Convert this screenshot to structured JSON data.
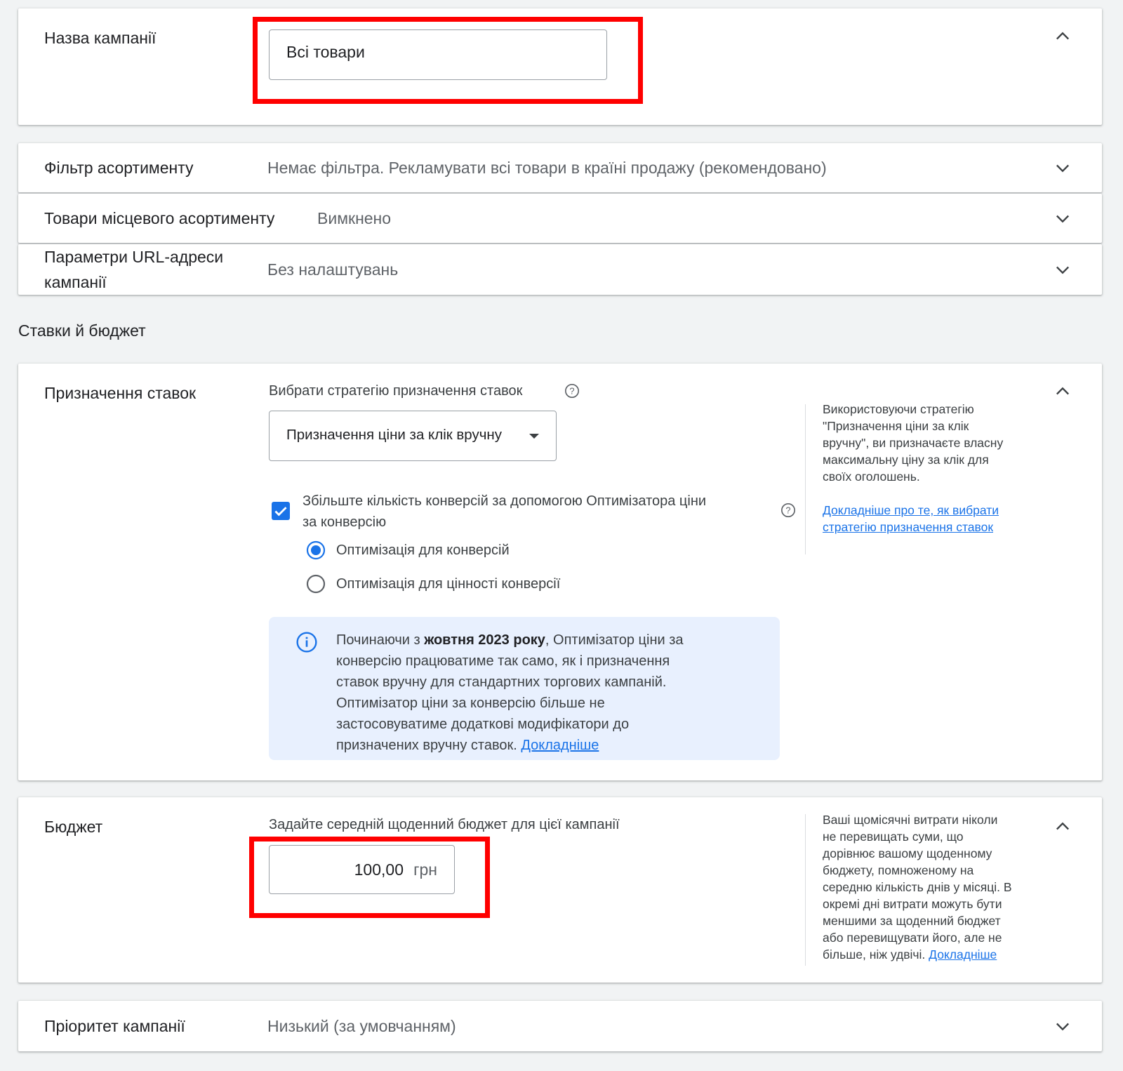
{
  "campaign_name": {
    "label": "Назва кампанії",
    "value": "Всі товари"
  },
  "inventory_filter": {
    "label": "Фільтр асортименту",
    "value": "Немає фільтра. Рекламувати всі товари в країні продажу (рекомендовано)"
  },
  "local_products": {
    "label": "Товари місцевого асортименту",
    "value": "Вимкнено"
  },
  "url_params": {
    "label_line1": "Параметри URL-адреси",
    "label_line2": "кампанії",
    "value": "Без налаштувань"
  },
  "section_title": "Ставки й бюджет",
  "bidding": {
    "label": "Призначення ставок",
    "strategy_prompt": "Вибрати стратегію призначення ставок",
    "strategy_selected": "Призначення ціни за клік вручну",
    "ecpc_label_line1": "Збільште кількість конверсій за допомогою Оптимізатора ціни",
    "ecpc_label_line2": "за конверсію",
    "ecpc_checked": true,
    "radio_conversions": "Оптимізація для конверсій",
    "radio_value": "Оптимізація для цінності конверсії",
    "radio_selected": "conversions",
    "notice_prefix": "Починаючи з ",
    "notice_bold": "жовтня 2023 року",
    "notice_line1_rest": ", Оптимізатор ціни за",
    "notice_line2": "конверсію працюватиме так само, як і призначення",
    "notice_line3": "ставок вручну для стандартних торгових кампаній.",
    "notice_line4": "Оптимізатор ціни за конверсію більше не",
    "notice_line5": "застосовуватиме додаткові модифікатори до",
    "notice_line6": "призначених вручну ставок.",
    "notice_link": "Докладніше",
    "side_line1": "Використовуючи стратегію",
    "side_line2": "\"Призначення ціни за клік",
    "side_line3": "вручну\", ви призначаєте власну",
    "side_line4": "максимальну ціну за клік для",
    "side_line5": "своїх оголошень.",
    "side_link_line1": "Докладніше про те, як вибрати",
    "side_link_line2": "стратегію призначення ставок"
  },
  "budget": {
    "label": "Бюджет",
    "prompt": "Задайте середній щоденний бюджет для цієї кампанії",
    "amount": "100,00",
    "currency": "грн",
    "side_line1": "Ваші щомісячні витрати ніколи",
    "side_line2": "не перевищать суми, що",
    "side_line3": "дорівнює вашому щоденному",
    "side_line4": "бюджету, помноженому на",
    "side_line5": "середню кількість днів у місяці. В",
    "side_line6": "окремі дні витрати можуть бути",
    "side_line7": "меншими за щоденний бюджет",
    "side_line8": "або перевищувати його, але не",
    "side_line9": "більше, ніж удвічі.",
    "side_link": "Докладніше"
  },
  "priority": {
    "label": "Пріоритет кампанії",
    "value": "Низький (за умовчанням)"
  },
  "colors": {
    "accent": "#1a73e8",
    "highlight_red": "#ff0000",
    "notice_bg": "#e8f0fe"
  }
}
